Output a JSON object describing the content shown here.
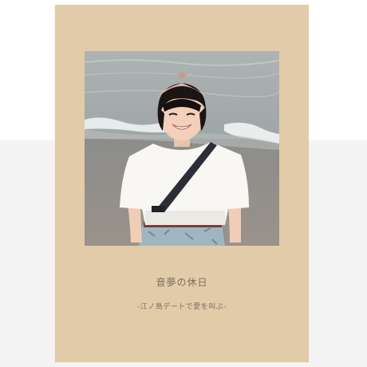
{
  "cover": {
    "title": "音夢の休日",
    "subtitle": "-江ノ島デートで愛を叫ぶ-",
    "background_color": "#e2cba8",
    "text_color": "#7a6e62"
  },
  "photo": {
    "icon": "portrait-photo"
  }
}
